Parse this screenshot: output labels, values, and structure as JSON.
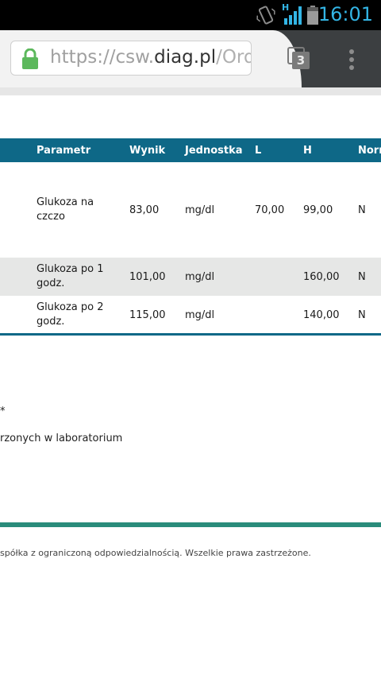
{
  "status_bar": {
    "time": "16:01",
    "network_type": "H",
    "icons": [
      "vibrate-icon",
      "signal-icon",
      "battery-icon"
    ]
  },
  "browser": {
    "url": {
      "scheme": "https://",
      "domain_prefix": "csw.",
      "domain": "diag.pl",
      "path": "/Order"
    },
    "tabs_count": "3",
    "icons": [
      "lock-icon",
      "tabs-icon",
      "menu-icon"
    ],
    "colors": {
      "lock": "#5cb85c",
      "toolbar": "#3c3f41"
    }
  },
  "table": {
    "headers": [
      "Parametr",
      "Wynik",
      "Jednostka",
      "L",
      "H",
      "Norm"
    ],
    "rows": [
      {
        "param": "Glukoza na czczo",
        "wynik": "83,00",
        "jednostka": "mg/dl",
        "l": "70,00",
        "h": "99,00",
        "norma": "N"
      },
      {
        "param": "Glukoza po 1 godz.",
        "wynik": "101,00",
        "jednostka": "mg/dl",
        "l": "",
        "h": "160,00",
        "norma": "N"
      },
      {
        "param": "Glukoza po 2 godz.",
        "wynik": "115,00",
        "jednostka": "mg/dl",
        "l": "",
        "h": "140,00",
        "norma": "N"
      }
    ],
    "colors": {
      "header_bg": "#0e6887",
      "alt_row_bg": "#e6e7e6"
    }
  },
  "notes": {
    "marker": "*",
    "text": "rzonych w laboratorium"
  },
  "footer": {
    "text": "spółka z ograniczoną odpowiedzialnością. Wszelkie prawa zastrzeżone.",
    "color": "#2a8c7b"
  }
}
